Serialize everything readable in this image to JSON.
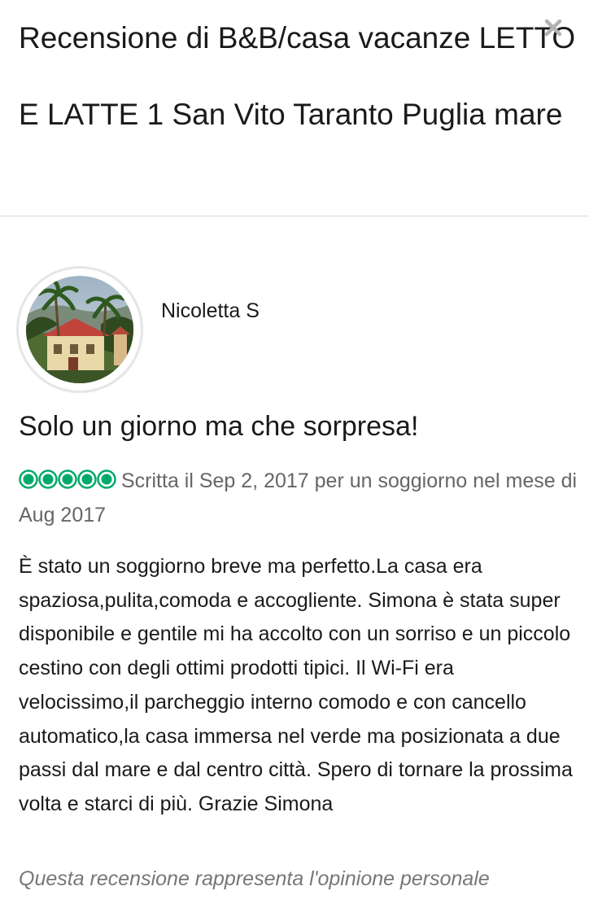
{
  "header": {
    "title": "Recensione di B&B/casa vacanze LETTO E LATTE 1 San Vito Taranto Puglia mare",
    "close_icon": "close-icon"
  },
  "reviewer": {
    "name": "Nicoletta S",
    "avatar_icon": "avatar-photo-house-palms"
  },
  "review": {
    "title": "Solo un giorno ma che sorpresa!",
    "rating": 5,
    "rating_max": 5,
    "rating_color": "#00aa6c",
    "meta": "Scritta il Sep 2, 2017 per un soggiorno nel mese di Aug 2017",
    "body": "È stato un soggiorno breve ma perfetto.La casa era spaziosa,pulita,comoda e accogliente. Simona è stata super disponibile e gentile mi ha accolto con un sorriso e un piccolo cestino con degli ottimi prodotti tipici. Il Wi-Fi era velocissimo,il parcheggio interno comodo e con cancello automatico,la casa immersa nel verde ma posizionata a due passi dal mare e dal centro città. Spero di tornare la prossima volta e starci di più. Grazie Simona",
    "disclaimer": "Questa recensione rappresenta l'opinione personale"
  }
}
